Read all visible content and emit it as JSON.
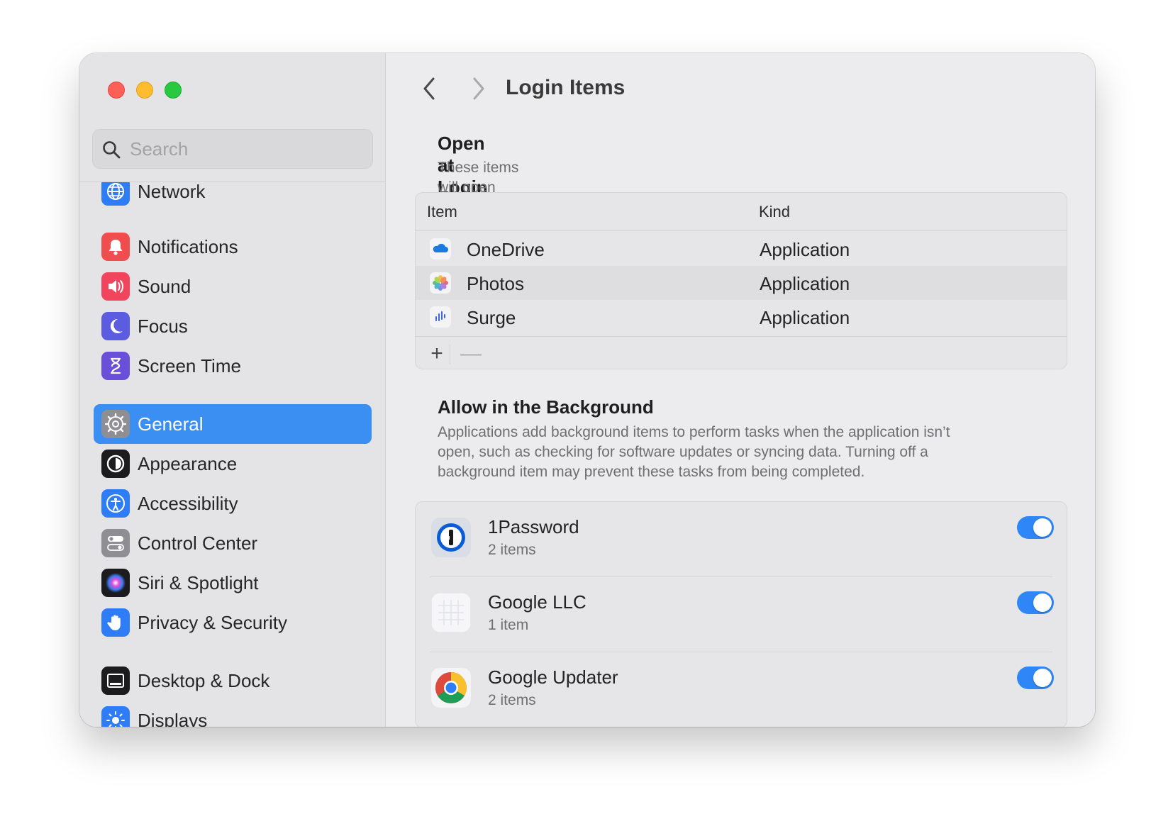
{
  "window": {
    "traffic_lights": [
      "close",
      "minimize",
      "zoom"
    ]
  },
  "sidebar": {
    "search": {
      "placeholder": "Search",
      "value": ""
    },
    "items": [
      {
        "label": "Network",
        "icon": "network-icon",
        "color": "#2f7df6",
        "selected": false
      },
      {
        "label": "Notifications",
        "icon": "notifications-icon",
        "color": "#f04e4e",
        "selected": false
      },
      {
        "label": "Sound",
        "icon": "sound-icon",
        "color": "#f0455c",
        "selected": false
      },
      {
        "label": "Focus",
        "icon": "focus-icon",
        "color": "#5b5ce0",
        "selected": false
      },
      {
        "label": "Screen Time",
        "icon": "screen-time-icon",
        "color": "#6a4fd8",
        "selected": false
      },
      {
        "label": "General",
        "icon": "general-icon",
        "color": "#8e8e93",
        "selected": true
      },
      {
        "label": "Appearance",
        "icon": "appearance-icon",
        "color": "#1c1c1e",
        "selected": false
      },
      {
        "label": "Accessibility",
        "icon": "accessibility-icon",
        "color": "#2f7df6",
        "selected": false
      },
      {
        "label": "Control Center",
        "icon": "control-center-icon",
        "color": "#8e8e93",
        "selected": false
      },
      {
        "label": "Siri & Spotlight",
        "icon": "siri-icon",
        "color": "#7a3fd1",
        "selected": false
      },
      {
        "label": "Privacy & Security",
        "icon": "privacy-icon",
        "color": "#2f7df6",
        "selected": false
      },
      {
        "label": "Desktop & Dock",
        "icon": "desktop-dock-icon",
        "color": "#1c1c1e",
        "selected": false
      },
      {
        "label": "Displays",
        "icon": "displays-icon",
        "color": "#2f7df6",
        "selected": false
      }
    ]
  },
  "header": {
    "title": "Login Items"
  },
  "open_at_login": {
    "title": "Open at Login",
    "description": "These items will open automatically when you log in.",
    "columns": [
      "Item",
      "Kind"
    ],
    "rows": [
      {
        "name": "OneDrive",
        "kind": "Application",
        "icon": "onedrive-icon"
      },
      {
        "name": "Photos",
        "kind": "Application",
        "icon": "photos-icon"
      },
      {
        "name": "Surge",
        "kind": "Application",
        "icon": "surge-icon"
      }
    ],
    "add_label": "+",
    "remove_label": "—"
  },
  "background": {
    "title": "Allow in the Background",
    "description_lines": [
      "Applications add background items to perform tasks when the application isn’t",
      "open, such as checking for software updates or syncing data. Turning off a",
      "background item may prevent these tasks from being completed."
    ],
    "items": [
      {
        "name": "1Password",
        "count": "2 items",
        "enabled": true,
        "icon": "1password-icon"
      },
      {
        "name": "Google LLC",
        "count": "1 item",
        "enabled": true,
        "icon": "google-llc-icon"
      },
      {
        "name": "Google Updater",
        "count": "2 items",
        "enabled": true,
        "icon": "chrome-icon"
      }
    ],
    "accent": "#2f86f6"
  }
}
